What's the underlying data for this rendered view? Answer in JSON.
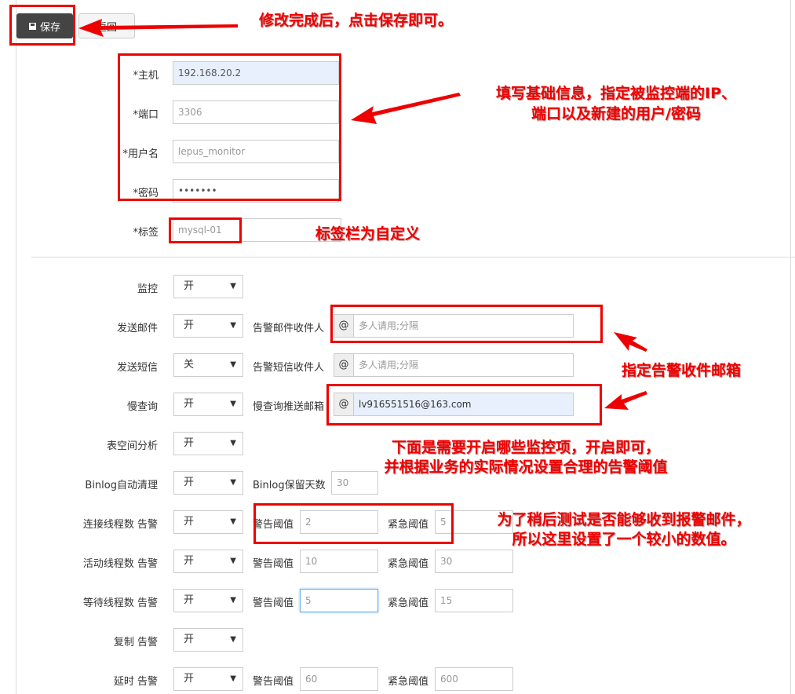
{
  "toolbar": {
    "save_label": "保存",
    "back_label": "返回"
  },
  "basic": {
    "host_label": "*主机",
    "host_value": "192.168.20.2",
    "port_label": "*端口",
    "port_value": "3306",
    "user_label": "*用户名",
    "user_value": "lepus_monitor",
    "pass_label": "*密码",
    "pass_value": "•••••••",
    "tag_label": "*标签",
    "tag_value": "mysql-01"
  },
  "settings": {
    "monitor": {
      "label": "监控",
      "value": "开"
    },
    "send_mail": {
      "label": "发送邮件",
      "value": "开",
      "field_label": "告警邮件收件人",
      "addon": "@",
      "placeholder": "多人请用;分隔"
    },
    "send_sms": {
      "label": "发送短信",
      "value": "关",
      "field_label": "告警短信收件人",
      "addon": "@",
      "placeholder": "多人请用;分隔"
    },
    "slow_query": {
      "label": "慢查询",
      "value": "开",
      "field_label": "慢查询推送邮箱",
      "addon": "@",
      "field_value": "lv916551516@163.com"
    },
    "tablespace": {
      "label": "表空间分析",
      "value": "开"
    },
    "binlog": {
      "label": "Binlog自动清理",
      "value": "开",
      "field_label": "Binlog保留天数",
      "field_value": "30"
    },
    "connect_threads": {
      "label": "连接线程数 告警",
      "value": "开",
      "warn_label": "警告阈值",
      "warn_value": "2",
      "crit_label": "紧急阈值",
      "crit_value": "5"
    },
    "active_threads": {
      "label": "活动线程数 告警",
      "value": "开",
      "warn_label": "警告阈值",
      "warn_value": "10",
      "crit_label": "紧急阈值",
      "crit_value": "30"
    },
    "waiting_threads": {
      "label": "等待线程数 告警",
      "value": "开",
      "warn_label": "警告阈值",
      "warn_value": "5",
      "crit_label": "紧急阈值",
      "crit_value": "15"
    },
    "replication": {
      "label": "复制 告警",
      "value": "开"
    },
    "delay": {
      "label": "延时 告警",
      "value": "开",
      "warn_label": "警告阈值",
      "warn_value": "60",
      "crit_label": "紧急阈值",
      "crit_value": "600"
    }
  },
  "annotations": {
    "save": "修改完成后，点击保存即可。",
    "basic_line1": "填写基础信息，指定被监控端的IP、",
    "basic_line2": "端口以及新建的用户/密码",
    "tag": "标签栏为自定义",
    "mail": "指定告警收件邮箱",
    "items_line1": "下面是需要开启哪些监控项，开启即可，",
    "items_line2": "并根据业务的实际情况设置合理的告警阈值",
    "threshold_line1": "为了稍后测试是否能够收到报警邮件，",
    "threshold_line2": "所以这里设置了一个较小的数值。"
  },
  "colors": {
    "annotation_red": "#e00000",
    "save_button_bg": "#444444",
    "autofill_bg": "#e8f0fe"
  }
}
